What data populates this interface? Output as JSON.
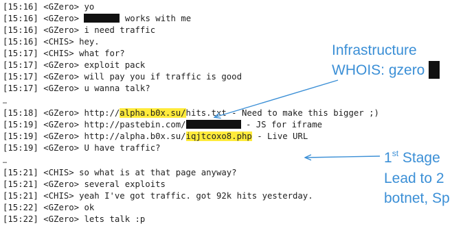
{
  "chat": {
    "block1": [
      {
        "time": "[15:16]",
        "nick": "<GZero>",
        "text": "yo"
      },
      {
        "time": "[15:16]",
        "nick": "<GZero>",
        "text": "works with me"
      },
      {
        "time": "[15:16]",
        "nick": "<GZero>",
        "text": "i need traffic"
      },
      {
        "time": "[15:16]",
        "nick": "<CHIS>",
        "text": "hey."
      },
      {
        "time": "[15:17]",
        "nick": "<CHIS>",
        "text": "what for?"
      },
      {
        "time": "[15:17]",
        "nick": "<GZero>",
        "text": "exploit pack"
      },
      {
        "time": "[15:17]",
        "nick": "<GZero>",
        "text": "will pay you if traffic is good"
      },
      {
        "time": "[15:17]",
        "nick": "<GZero>",
        "text": "u wanna talk?"
      }
    ],
    "separator": "…",
    "block2": [
      {
        "time": "[15:18]",
        "nick": "<GZero>",
        "pre": "http://",
        "hl": "alpha.b0x.su/",
        "post": "hits.txt - Need to make this bigger ;)"
      },
      {
        "time": "[15:19]",
        "nick": "<GZero>",
        "pre": "http://pastebin.com/",
        "post": " - JS for iframe"
      },
      {
        "time": "[15:19]",
        "nick": "<GZero>",
        "pre": "http://alpha.b0x.su/",
        "hl": "iqjtcoxo8.php",
        "post": " - Live URL"
      },
      {
        "time": "[15:19]",
        "nick": "<GZero>",
        "text": "U have traffic?"
      }
    ],
    "block3": [
      {
        "time": "[15:21]",
        "nick": "<CHIS>",
        "text": "so what is at that page anyway?"
      },
      {
        "time": "[15:21]",
        "nick": "<GZero>",
        "text": "several exploits"
      },
      {
        "time": "[15:21]",
        "nick": "<CHIS>",
        "text": "yeah I've got traffic. got 92k hits yesterday."
      },
      {
        "time": "[15:22]",
        "nick": "<GZero>",
        "text": "ok"
      },
      {
        "time": "[15:22]",
        "nick": "<GZero>",
        "text": "lets talk :p"
      }
    ]
  },
  "annotations": {
    "infra_line1": "Infrastructure",
    "infra_line2": "WHOIS:  gzero",
    "stage_num": "1",
    "stage_sup": "st",
    "stage_rest": " Stage",
    "stage_line2": "Lead to 2",
    "stage_line3": "botnet, Sp"
  },
  "colors": {
    "annotation": "#3b8fd6",
    "highlight": "#ffeb3b",
    "redaction": "#111111"
  }
}
